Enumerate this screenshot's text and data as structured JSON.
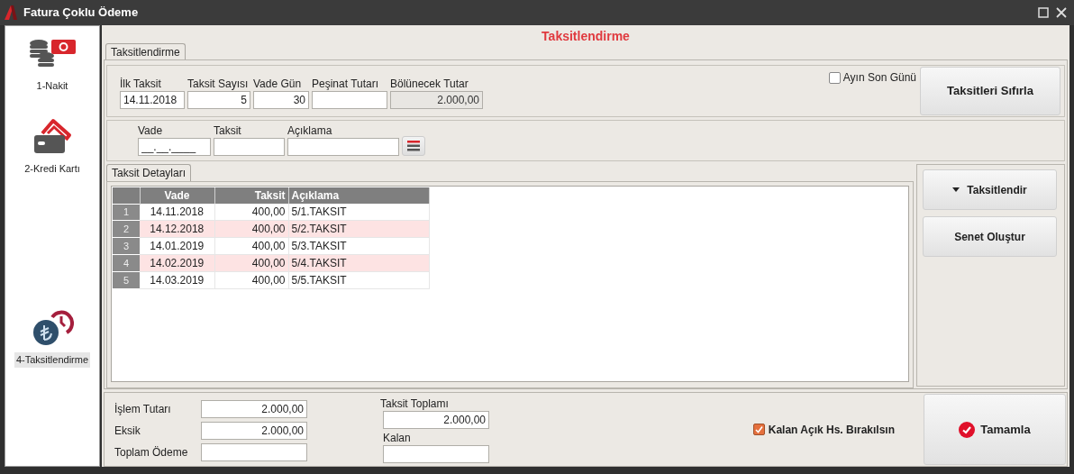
{
  "window": {
    "title": "Fatura Çoklu Ödeme"
  },
  "sidebar": {
    "items": [
      {
        "label": "1-Nakit",
        "kind": "cash",
        "selected": false
      },
      {
        "label": "2-Kredi Kartı",
        "kind": "card",
        "selected": false
      },
      {
        "label": "4-Taksitlendirme",
        "kind": "installment",
        "selected": true
      }
    ]
  },
  "heading": "Taksitlendirme",
  "tabs": [
    {
      "label": "Taksitlendirme",
      "selected": true
    }
  ],
  "plan": {
    "fields": [
      {
        "label": "İlk Taksit",
        "value": "14.11.2018",
        "kind": "date",
        "disabled": false
      },
      {
        "label": "Taksit Sayısı",
        "value": "5",
        "kind": "number",
        "disabled": false
      },
      {
        "label": "Vade Gün",
        "value": "30",
        "kind": "number",
        "disabled": false
      },
      {
        "label": "Peşinat Tutarı",
        "kind": "number",
        "disabled": false
      },
      {
        "label": "Bölünecek Tutar",
        "value": "2.000,00",
        "kind": "number",
        "disabled": true
      }
    ],
    "last_day": {
      "label": "Ayın Son Günü",
      "checked": false
    },
    "reset_button": "Taksitleri Sıfırla"
  },
  "entry": {
    "fields": [
      {
        "label": "Vade",
        "value": "__.__.____"
      },
      {
        "label": "Taksit"
      },
      {
        "label": "Açıklama"
      }
    ]
  },
  "detail_tabs": [
    {
      "label": "Taksit Detayları",
      "selected": true
    }
  ],
  "table": {
    "columns": [
      "Vade",
      "Taksit",
      "Açıklama"
    ],
    "rows": [
      {
        "index": "1",
        "cells": [
          "14.11.2018",
          "400,00",
          "5/1.TAKSIT"
        ]
      },
      {
        "index": "2",
        "cells": [
          "14.12.2018",
          "400,00",
          "5/2.TAKSIT"
        ]
      },
      {
        "index": "3",
        "cells": [
          "14.01.2019",
          "400,00",
          "5/3.TAKSIT"
        ]
      },
      {
        "index": "4",
        "cells": [
          "14.02.2019",
          "400,00",
          "5/4.TAKSIT"
        ]
      },
      {
        "index": "5",
        "cells": [
          "14.03.2019",
          "400,00",
          "5/5.TAKSIT"
        ]
      }
    ]
  },
  "actions": [
    {
      "label": "Taksitlendir",
      "kind": "dropdown"
    },
    {
      "label": "Senet Oluştur",
      "kind": "plain"
    }
  ],
  "summary": {
    "left_fields": [
      {
        "label": "İşlem Tutarı",
        "value": "2.000,00"
      },
      {
        "label": "Eksik",
        "value": "2.000,00"
      },
      {
        "label": "Toplam Ödeme"
      }
    ],
    "right_fields": [
      {
        "label": "Taksit Toplamı",
        "value": "2.000,00"
      },
      {
        "label": "Kalan"
      }
    ],
    "leave_open": {
      "label": "Kalan Açık Hs. Bırakılsın",
      "checked": true
    },
    "complete_button": "Tamamla"
  }
}
